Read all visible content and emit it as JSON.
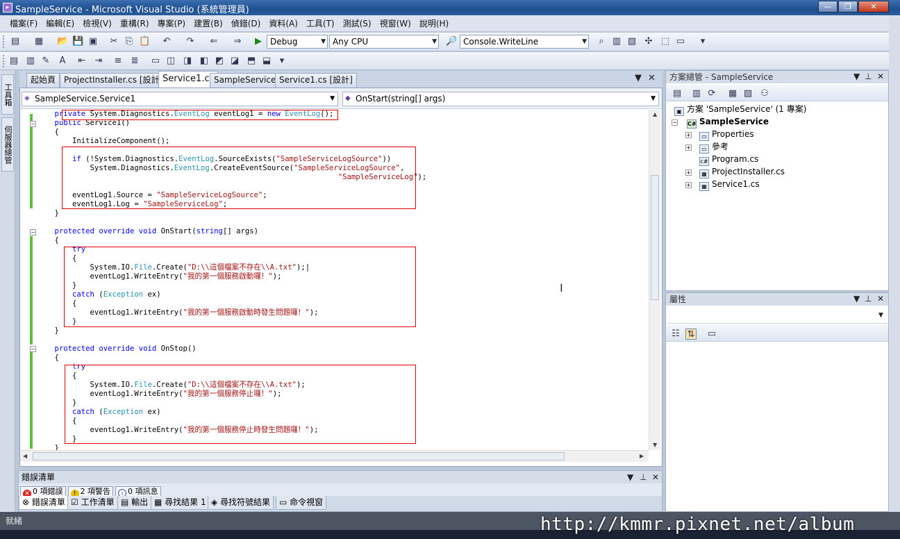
{
  "window": {
    "title": "SampleService - Microsoft Visual Studio (系統管理員)",
    "minimize": "—",
    "restore": "❐",
    "close": "✕"
  },
  "menu": [
    "檔案(F)",
    "編輯(E)",
    "檢視(V)",
    "重構(R)",
    "專案(P)",
    "建置(B)",
    "偵錯(D)",
    "資料(A)",
    "工具(T)",
    "測試(S)",
    "視窗(W)",
    "說明(H)"
  ],
  "toolbar": {
    "config": "Debug",
    "platform": "Any CPU",
    "find": "Console.WriteLine"
  },
  "left_tabs": [
    "工具箱",
    "伺服器總管"
  ],
  "doc_tabs": [
    "起始頁",
    "ProjectInstaller.cs [設計]",
    "Service1.cs",
    "SampleService",
    "Service1.cs [設計]"
  ],
  "doc_controls": {
    "dropdown": "▼",
    "close": "✕"
  },
  "editor": {
    "class_combo": "SampleService.Service1",
    "member_combo": "OnStart(string[] args)",
    "lines": [
      [
        [
          "",
          "    "
        ],
        [
          "kw",
          "private"
        ],
        [
          "",
          " System.Diagnostics."
        ],
        [
          "ty",
          "EventLog"
        ],
        [
          "",
          " eventLog1 = "
        ],
        [
          "kw",
          "new"
        ],
        [
          "",
          " "
        ],
        [
          "ty",
          "EventLog"
        ],
        [
          "",
          "();"
        ]
      ],
      [
        [
          "",
          "    "
        ],
        [
          "kw",
          "public"
        ],
        [
          "",
          " Service1()"
        ]
      ],
      [
        [
          "",
          "    {"
        ]
      ],
      [
        [
          "",
          "        InitializeComponent();"
        ]
      ],
      [
        [
          "",
          ""
        ]
      ],
      [
        [
          "",
          "        "
        ],
        [
          "kw",
          "if"
        ],
        [
          "",
          " (!System.Diagnostics."
        ],
        [
          "ty",
          "EventLog"
        ],
        [
          "",
          ".SourceExists("
        ],
        [
          "st",
          "\"SampleServiceLogSource\""
        ],
        [
          "",
          "))"
        ]
      ],
      [
        [
          "",
          "            System.Diagnostics."
        ],
        [
          "ty",
          "EventLog"
        ],
        [
          "",
          ".CreateEventSource("
        ],
        [
          "st",
          "\"SampleServiceLogSource\""
        ],
        [
          "",
          ","
        ]
      ],
      [
        [
          "",
          "                                                                    "
        ],
        [
          "st",
          "\"SampleServiceLog\""
        ],
        [
          "",
          ");"
        ]
      ],
      [
        [
          "",
          ""
        ]
      ],
      [
        [
          "",
          "        eventLog1.Source = "
        ],
        [
          "st",
          "\"SampleServiceLogSource\""
        ],
        [
          "",
          ";"
        ]
      ],
      [
        [
          "",
          "        eventLog1.Log = "
        ],
        [
          "st",
          "\"SampleServiceLog\""
        ],
        [
          "",
          ";"
        ]
      ],
      [
        [
          "",
          "    }"
        ]
      ],
      [
        [
          "",
          ""
        ]
      ],
      [
        [
          "",
          "    "
        ],
        [
          "kw",
          "protected"
        ],
        [
          "",
          " "
        ],
        [
          "kw",
          "override"
        ],
        [
          "",
          " "
        ],
        [
          "kw",
          "void"
        ],
        [
          "",
          " OnStart("
        ],
        [
          "kw",
          "string"
        ],
        [
          "",
          "[] args)"
        ]
      ],
      [
        [
          "",
          "    {"
        ]
      ],
      [
        [
          "",
          "        "
        ],
        [
          "kw",
          "try"
        ]
      ],
      [
        [
          "",
          "        {"
        ]
      ],
      [
        [
          "",
          "            System.IO."
        ],
        [
          "ty",
          "File"
        ],
        [
          "",
          ".Create("
        ],
        [
          "st",
          "\"D:\\\\這個檔案不存在\\\\A.txt\""
        ],
        [
          "",
          ");|"
        ]
      ],
      [
        [
          "",
          "            eventLog1.WriteEntry("
        ],
        [
          "st",
          "\"我的第一個服務啟動囉！\""
        ],
        [
          "",
          ");"
        ]
      ],
      [
        [
          "",
          "        }"
        ]
      ],
      [
        [
          "",
          "        "
        ],
        [
          "kw",
          "catch"
        ],
        [
          "",
          " ("
        ],
        [
          "ty",
          "Exception"
        ],
        [
          "",
          " ex)"
        ]
      ],
      [
        [
          "",
          "        {"
        ]
      ],
      [
        [
          "",
          "            eventLog1.WriteEntry("
        ],
        [
          "st",
          "\"我的第一個服務啟動時發生問題囉！\""
        ],
        [
          "",
          ");"
        ]
      ],
      [
        [
          "",
          "        }"
        ]
      ],
      [
        [
          "",
          "    }"
        ]
      ],
      [
        [
          "",
          ""
        ]
      ],
      [
        [
          "",
          "    "
        ],
        [
          "kw",
          "protected"
        ],
        [
          "",
          " "
        ],
        [
          "kw",
          "override"
        ],
        [
          "",
          " "
        ],
        [
          "kw",
          "void"
        ],
        [
          "",
          " OnStop()"
        ]
      ],
      [
        [
          "",
          "    {"
        ]
      ],
      [
        [
          "",
          "        "
        ],
        [
          "kw",
          "try"
        ]
      ],
      [
        [
          "",
          "        {"
        ]
      ],
      [
        [
          "",
          "            System.IO."
        ],
        [
          "ty",
          "File"
        ],
        [
          "",
          ".Create("
        ],
        [
          "st",
          "\"D:\\\\這個檔案不存在\\\\A.txt\""
        ],
        [
          "",
          ");"
        ]
      ],
      [
        [
          "",
          "            eventLog1.WriteEntry("
        ],
        [
          "st",
          "\"我的第一個服務停止囉！\""
        ],
        [
          "",
          ");"
        ]
      ],
      [
        [
          "",
          "        }"
        ]
      ],
      [
        [
          "",
          "        "
        ],
        [
          "kw",
          "catch"
        ],
        [
          "",
          " ("
        ],
        [
          "ty",
          "Exception"
        ],
        [
          "",
          " ex)"
        ]
      ],
      [
        [
          "",
          "        {"
        ]
      ],
      [
        [
          "",
          "            eventLog1.WriteEntry("
        ],
        [
          "st",
          "\"我的第一個服務停止時發生問題囉！\""
        ],
        [
          "",
          ");"
        ]
      ],
      [
        [
          "",
          "        }"
        ]
      ],
      [
        [
          "",
          "    }"
        ]
      ]
    ]
  },
  "error_panel": {
    "title": "錯誤清單",
    "errors": "0 項錯誤",
    "warnings": "2 項警告",
    "messages": "0 項訊息"
  },
  "bottom_tabs": [
    "錯誤清單",
    "工作清單",
    "輸出",
    "尋找結果 1",
    "尋找符號結果",
    "命令視窗"
  ],
  "solution_explorer": {
    "title": "方案總管 - SampleService",
    "solution": "方案 'SampleService' (1 專案)",
    "project": "SampleService",
    "items": [
      "Properties",
      "參考",
      "Program.cs",
      "ProjectInstaller.cs",
      "Service1.cs"
    ]
  },
  "properties_panel": {
    "title": "屬性"
  },
  "status": {
    "text": "就緒"
  },
  "watermark": "http://kmmr.pixnet.net/album"
}
